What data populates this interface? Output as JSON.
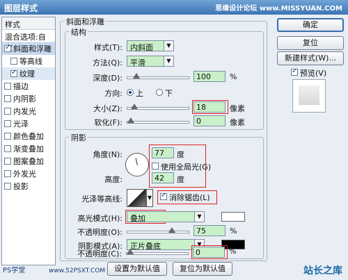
{
  "window": {
    "title": "图层样式",
    "watermark": "思缘设计论坛 www.MISSYUAN.COM"
  },
  "sidebar": {
    "header": "样式",
    "blend": "混合选项:自定",
    "items": [
      {
        "label": "斜面和浮雕",
        "checked": true,
        "selected": true,
        "sub": false
      },
      {
        "label": "等高线",
        "checked": false,
        "selected": false,
        "sub": true
      },
      {
        "label": "纹理",
        "checked": true,
        "selected": false,
        "sub": true
      },
      {
        "label": "描边",
        "checked": false,
        "selected": false,
        "sub": false
      },
      {
        "label": "内阴影",
        "checked": false,
        "selected": false,
        "sub": false
      },
      {
        "label": "内发光",
        "checked": false,
        "selected": false,
        "sub": false
      },
      {
        "label": "光泽",
        "checked": false,
        "selected": false,
        "sub": false
      },
      {
        "label": "颜色叠加",
        "checked": false,
        "selected": false,
        "sub": false
      },
      {
        "label": "渐变叠加",
        "checked": false,
        "selected": false,
        "sub": false
      },
      {
        "label": "图案叠加",
        "checked": false,
        "selected": false,
        "sub": false
      },
      {
        "label": "外发光",
        "checked": false,
        "selected": false,
        "sub": false
      },
      {
        "label": "投影",
        "checked": false,
        "selected": false,
        "sub": false
      }
    ]
  },
  "bevel": {
    "group_title": "斜面和浮雕",
    "structure_title": "结构",
    "style_label": "样式(T):",
    "style_value": "内斜面",
    "technique_label": "方法(Q):",
    "technique_value": "平滑",
    "depth_label": "深度(D):",
    "depth_value": "100",
    "depth_unit": "%",
    "depth_fraction": 0.1,
    "direction_label": "方向:",
    "dir_up": "上",
    "dir_down": "下",
    "size_label": "大小(Z):",
    "size_value": "18",
    "size_unit": "像素",
    "size_fraction": 0.07,
    "soften_label": "软化(F):",
    "soften_value": "0",
    "soften_unit": "像素",
    "soften_fraction": 0.0
  },
  "shading": {
    "title": "阴影",
    "angle_label": "角度(N):",
    "angle_value": "77",
    "angle_unit": "度",
    "global_light_label": "使用全局光(G)",
    "altitude_label": "高度:",
    "altitude_value": "42",
    "altitude_unit": "度",
    "gloss_label": "光泽等高线:",
    "antialias_label": "消除锯齿(L)",
    "highlight_mode_label": "高光模式(H):",
    "highlight_mode_value": "叠加",
    "highlight_color": "#ffffff",
    "highlight_opacity_label": "不透明度(O):",
    "highlight_opacity_value": "75",
    "highlight_opacity_unit": "%",
    "highlight_opacity_fraction": 0.75,
    "shadow_mode_label": "阴影模式(A):",
    "shadow_mode_value": "正片叠底",
    "shadow_color": "#000000",
    "shadow_opacity_label": "不透明度(C):",
    "shadow_opacity_value": "0",
    "shadow_opacity_unit": "%",
    "shadow_opacity_fraction": 0.0
  },
  "buttons": {
    "ok": "确定",
    "reset": "复位",
    "new_style": "新建样式(W)...",
    "preview": "预览(V)",
    "set_default": "设置为默认值",
    "reset_default": "复位为默认值"
  },
  "footer": {
    "logo": "PS学堂",
    "site": "www.52PSXT.COM",
    "brand": "站长之库"
  },
  "colors": {
    "field_bg": "#c9f0c9",
    "highlight_box": "#e02020",
    "accent": "#3c6db0"
  }
}
